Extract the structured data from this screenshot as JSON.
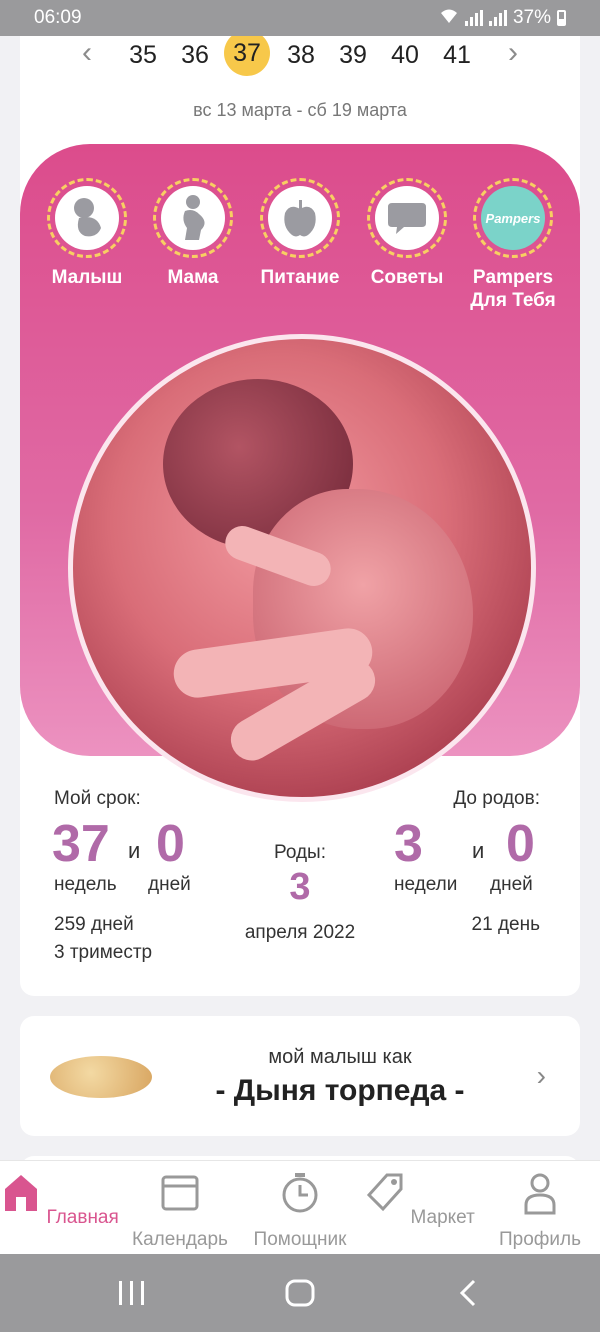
{
  "status": {
    "time": "06:09",
    "battery": "37%"
  },
  "week_nav": {
    "weeks": [
      "35",
      "36",
      "37",
      "38",
      "39",
      "40",
      "41"
    ],
    "active": "37",
    "range": "вс 13 марта - сб 19 марта"
  },
  "categories": [
    {
      "label": "Малыш",
      "icon": "baby-icon"
    },
    {
      "label": "Мама",
      "icon": "mother-icon"
    },
    {
      "label": "Питание",
      "icon": "apple-icon"
    },
    {
      "label": "Советы",
      "icon": "chat-bubble-icon"
    },
    {
      "label1": "Pampers",
      "label2": "Для Тебя",
      "logo": "Pampers",
      "icon": "pampers-logo"
    }
  ],
  "stats": {
    "my_term_label": "Мой срок:",
    "weeks_value": "37",
    "and1": "и",
    "days_value": "0",
    "weeks_unit": "недель",
    "days_unit": "дней",
    "days_total": "259 дней",
    "trimester": "3 триместр",
    "birth_label": "Роды:",
    "birth_day": "3",
    "birth_month": "апреля 2022",
    "until_label": "До родов:",
    "until_weeks": "3",
    "and2": "и",
    "until_days": "0",
    "until_weeks_unit": "недели",
    "until_days_unit": "дней",
    "until_total": "21 день"
  },
  "size_card": {
    "line1": "мой малыш как",
    "line2": "- Дыня торпеда -"
  },
  "bottom_nav": [
    {
      "label": "Главная",
      "icon": "home-icon",
      "active": true
    },
    {
      "label": "Календарь",
      "icon": "calendar-icon"
    },
    {
      "label": "Помощник",
      "icon": "timer-icon"
    },
    {
      "label": "Маркет",
      "icon": "tag-icon"
    },
    {
      "label": "Профиль",
      "icon": "profile-icon"
    }
  ],
  "colors": {
    "accent_pink": "#dc4c8c",
    "number_purple": "#b06aa8",
    "week_highlight": "#f7c84a",
    "nav_active": "#d9558f"
  }
}
